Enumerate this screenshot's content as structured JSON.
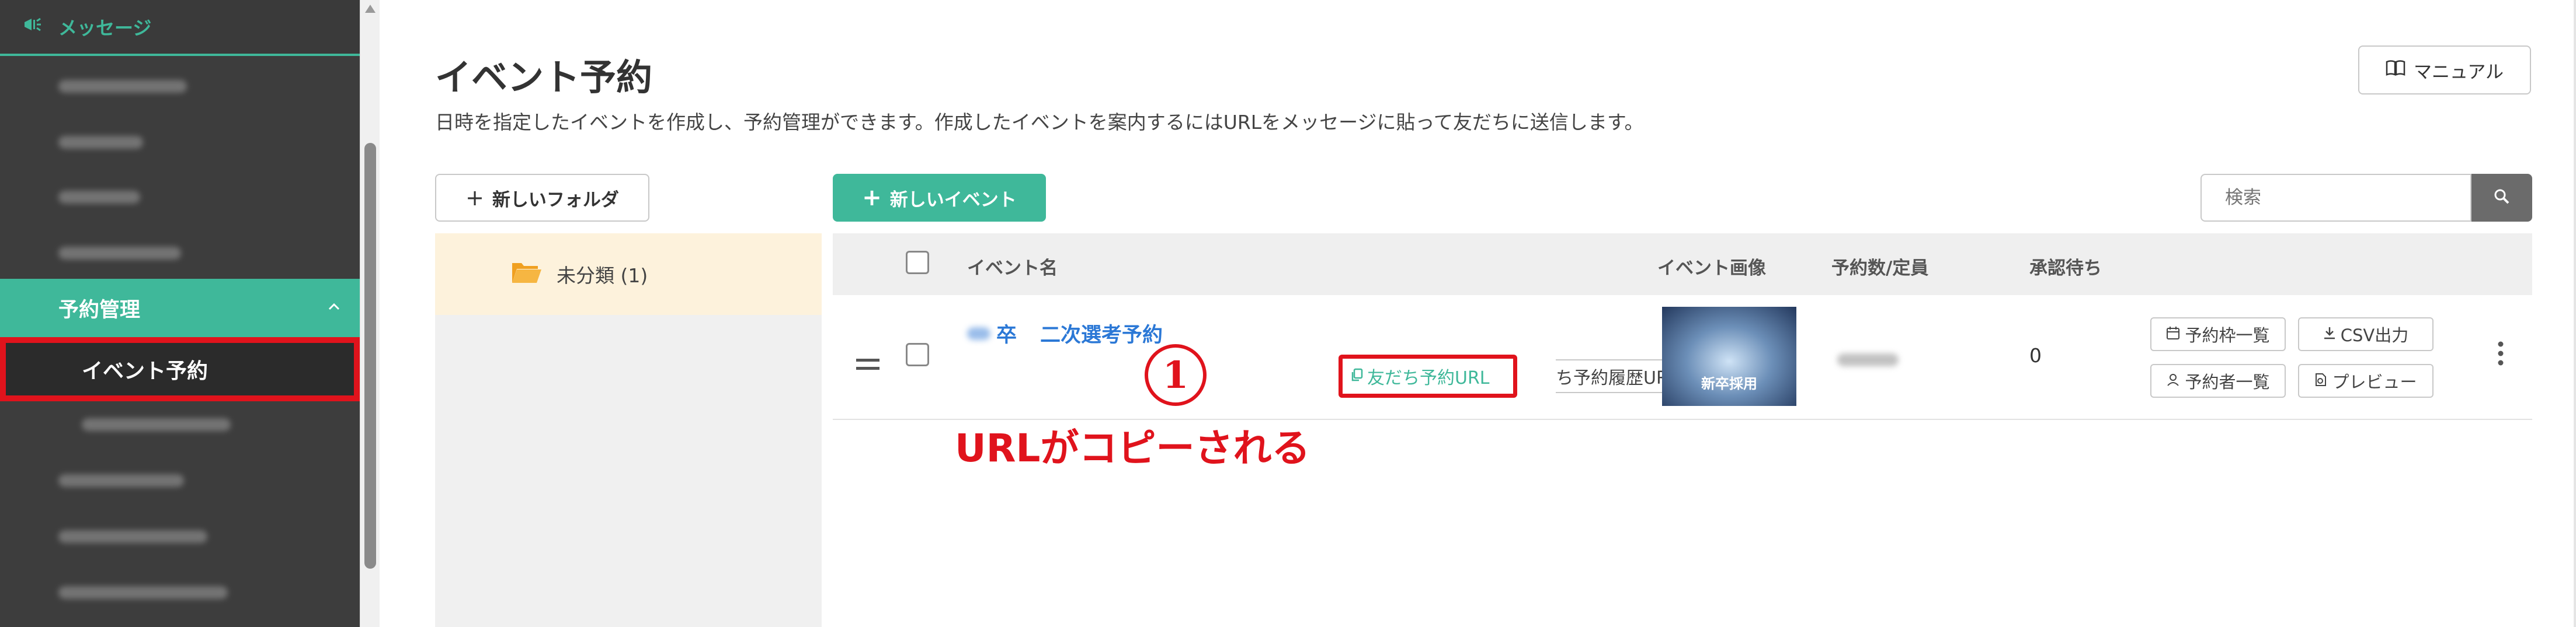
{
  "sidebar": {
    "top_label": "メッセージ",
    "active_label": "予約管理",
    "sub_active_label": "イベント予約"
  },
  "header": {
    "title": "イベント予約",
    "description": "日時を指定したイベントを作成し、予約管理ができます。作成したイベントを案内するにはURLをメッセージに貼って友だちに送信します。",
    "manual_label": "マニュアル"
  },
  "toolbar": {
    "new_folder_label": "新しいフォルダ",
    "new_event_label": "新しいイベント",
    "search_placeholder": "検索"
  },
  "folders": [
    {
      "label": "未分類 (1)"
    }
  ],
  "table": {
    "columns": [
      "イベント名",
      "イベント画像",
      "予約数/定員",
      "承認待ち"
    ],
    "rows": [
      {
        "name_prefix": "卒",
        "name": "二次選考予約",
        "friend_url_label": "友だち予約URL",
        "history_url_label": "ち予約履歴URL",
        "image_title": "新卒採用",
        "pending": "0",
        "actions": {
          "slots": "予約枠一覧",
          "csv": "CSV出力",
          "reservers": "予約者一覧",
          "preview": "プレビュー"
        }
      }
    ]
  },
  "annotation": {
    "number": "1",
    "text": "URLがコピーされる"
  },
  "colors": {
    "accent": "#3fb89a",
    "highlight": "#e0131c",
    "link": "#2b78d6"
  }
}
